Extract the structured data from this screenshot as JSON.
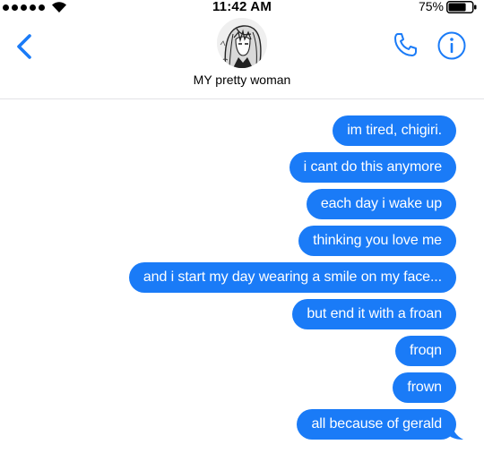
{
  "status_bar": {
    "time": "11:42 AM",
    "battery_percent": "75%",
    "battery_level": 0.75,
    "signal_icon": "signal-dots-icon",
    "wifi_icon": "wifi-icon",
    "battery_icon": "battery-icon"
  },
  "header": {
    "contact_name": "MY pretty woman",
    "back_icon": "chevron-left-icon",
    "phone_icon": "phone-icon",
    "info_icon": "info-icon",
    "accent_color": "#1a7bf7"
  },
  "messages": [
    {
      "text": "im tired, chigiri.",
      "sender": "me"
    },
    {
      "text": "i cant do this anymore",
      "sender": "me"
    },
    {
      "text": "each day i wake up",
      "sender": "me"
    },
    {
      "text": "thinking you love me",
      "sender": "me"
    },
    {
      "text": "and i start my day wearing a smile on my face...",
      "sender": "me"
    },
    {
      "text": "but end it with a froan",
      "sender": "me"
    },
    {
      "text": "froqn",
      "sender": "me"
    },
    {
      "text": "frown",
      "sender": "me"
    },
    {
      "text": "all because of gerald",
      "sender": "me",
      "tail": true
    }
  ],
  "bubble_color": "#1a7bf7"
}
